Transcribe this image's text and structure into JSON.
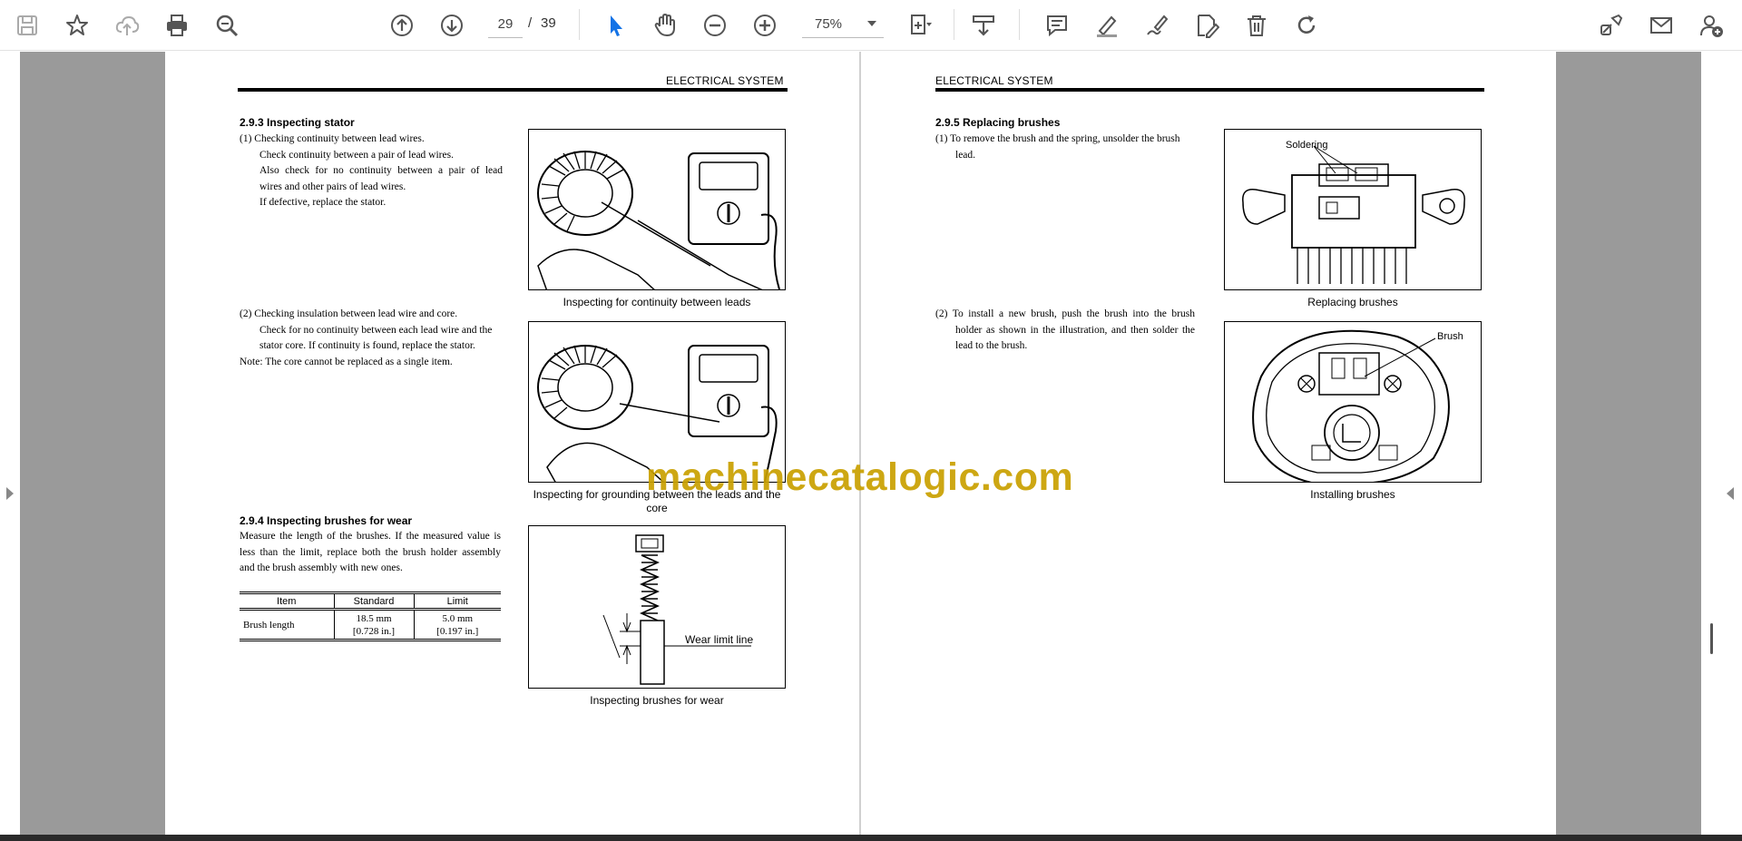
{
  "toolbar": {
    "left_icons": [
      "save-icon",
      "bookmark-star-icon",
      "cloud-upload-icon",
      "print-icon",
      "zoom-search-icon"
    ],
    "nav_icons": [
      "page-up-icon",
      "page-down-icon"
    ],
    "current_page": "29",
    "slash": "/",
    "total_pages": "39",
    "tool_icons": [
      "select-cursor-icon",
      "hand-pan-icon",
      "zoom-out-icon",
      "zoom-in-icon"
    ],
    "zoom": "75%",
    "right_icons": [
      "fit-page-icon",
      "download-icon",
      "comment-icon",
      "highlight-icon",
      "sign-icon",
      "edit-pdf-icon",
      "delete-icon",
      "rotate-icon",
      "share-link-icon",
      "email-icon",
      "account-icon"
    ],
    "accent_color": "#1473e6"
  },
  "left_page": {
    "header": "ELECTRICAL SYSTEM",
    "s293": {
      "title": "2.9.3    Inspecting stator",
      "p1": [
        "(1)  Checking continuity between lead wires.",
        "Check continuity between a pair of lead wires.",
        "Also check for no continuity between a pair of lead",
        "wires and other pairs of lead wires.",
        "If defective, replace the stator."
      ],
      "fig1_caption": "Inspecting for continuity between leads",
      "p2": [
        "(2)  Checking insulation between lead wire and core.",
        "Check for no continuity between each lead wire and the",
        "stator core. If continuity is found, replace the stator.",
        "Note: The core cannot be replaced as a single item."
      ],
      "fig2_caption": "Inspecting for grounding between the leads and the core"
    },
    "s294": {
      "title": "2.9.4    Inspecting brushes for wear",
      "body": [
        "Measure the length of the brushes. If the measured value is",
        "less than the limit, replace both the brush holder assembly",
        "and the brush assembly with new ones."
      ],
      "table": {
        "headers": [
          "Item",
          "Standard",
          "Limit"
        ],
        "row": {
          "item": "Brush length",
          "standard_mm": "18.5 mm",
          "standard_in": "[0.728 in.]",
          "limit_mm": "5.0 mm",
          "limit_in": "[0.197 in.]"
        }
      },
      "fig_label": "Wear limit line",
      "fig_caption": "Inspecting brushes for wear"
    }
  },
  "right_page": {
    "header": "ELECTRICAL SYSTEM",
    "s295": {
      "title": "2.9.5    Replacing brushes",
      "p1": [
        "(1)  To remove the brush and the spring, unsolder the brush",
        "lead."
      ],
      "fig1_label": "Soldering",
      "fig1_caption": "Replacing brushes",
      "p2": [
        "(2)  To install a new brush, push the brush into the brush",
        "holder as shown in the illustration,  and then solder the",
        "lead to the brush."
      ],
      "fig2_label": "Brush",
      "fig2_caption": "Installing brushes"
    }
  },
  "watermark": "machinecatalogic.com"
}
